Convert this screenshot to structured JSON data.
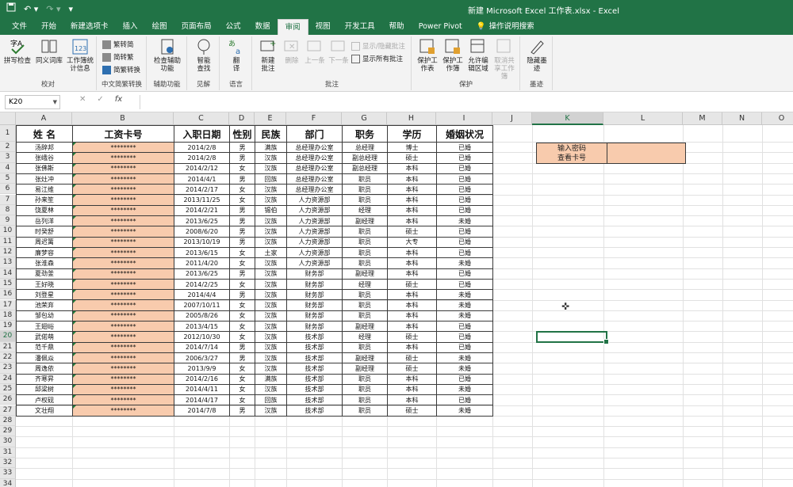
{
  "window": {
    "title": "新建 Microsoft Excel 工作表.xlsx  -  Excel"
  },
  "quick_access": {
    "save_icon": "save-icon",
    "undo_icon": "undo-icon",
    "redo_icon": "redo-icon",
    "customize_icon": "customize-icon"
  },
  "tabs": [
    {
      "label": "文件"
    },
    {
      "label": "开始"
    },
    {
      "label": "新建选项卡"
    },
    {
      "label": "插入"
    },
    {
      "label": "绘图"
    },
    {
      "label": "页面布局"
    },
    {
      "label": "公式"
    },
    {
      "label": "数据"
    },
    {
      "label": "审阅",
      "active": true
    },
    {
      "label": "视图"
    },
    {
      "label": "开发工具"
    },
    {
      "label": "帮助"
    },
    {
      "label": "Power Pivot"
    },
    {
      "label": "操作说明搜索"
    }
  ],
  "ribbon": {
    "proofing": {
      "label": "校对",
      "spell": "拼写检查",
      "thesaurus": "同义词库",
      "stats": "工作簿统计信息"
    },
    "chinese": {
      "label": "中文简繁转换",
      "to_simplified": "繁转简",
      "to_traditional": "简转繁",
      "convert": "简繁转换"
    },
    "accessibility": {
      "label": "辅助功能",
      "check": "检查辅助功能"
    },
    "insights": {
      "label": "见解",
      "smart": "智能查找"
    },
    "language": {
      "label": "语言",
      "translate": "翻译"
    },
    "comments": {
      "label": "批注",
      "new": "新建批注",
      "delete": "删除",
      "prev": "上一条",
      "next": "下一条",
      "show_hide": "显示/隐藏批注",
      "show_all": "显示所有批注"
    },
    "protect": {
      "label": "保护",
      "sheet": "保护工作表",
      "workbook": "保护工作簿",
      "allow_edit": "允许编辑区域",
      "unshare": "取消共享工作簿"
    },
    "ink": {
      "label": "墨迹",
      "hide_ink": "隐藏墨迹"
    }
  },
  "formula_bar": {
    "name_box": "K20",
    "cancel": "✕",
    "enter": "✓",
    "fx": "fx",
    "value": ""
  },
  "columns": [
    "A",
    "B",
    "C",
    "D",
    "E",
    "F",
    "G",
    "H",
    "I",
    "J",
    "K",
    "L",
    "M",
    "N",
    "O"
  ],
  "rows": [
    "1",
    "2",
    "3",
    "4",
    "5",
    "6",
    "7",
    "8",
    "9",
    "10",
    "11",
    "12",
    "13",
    "14",
    "15",
    "16",
    "17",
    "18",
    "19",
    "20",
    "21",
    "22",
    "23",
    "24",
    "25",
    "26",
    "27",
    "28",
    "29",
    "30",
    "31",
    "32",
    "33",
    "34",
    "35"
  ],
  "table": {
    "headers": [
      "姓 名",
      "工资卡号",
      "入职日期",
      "性别",
      "民族",
      "部门",
      "职务",
      "学历",
      "婚姻状况"
    ],
    "rows": [
      [
        "汤辞邦",
        "********",
        "2014/2/8",
        "男",
        "满族",
        "总经理办公室",
        "总经理",
        "博士",
        "已婚"
      ],
      [
        "张峨谷",
        "********",
        "2014/2/8",
        "男",
        "汉族",
        "总经理办公室",
        "副总经理",
        "硕士",
        "已婚"
      ],
      [
        "张佛斯",
        "********",
        "2014/2/12",
        "女",
        "汉族",
        "总经理办公室",
        "副总经理",
        "本科",
        "已婚"
      ],
      [
        "张灶冲",
        "********",
        "2014/4/1",
        "男",
        "回族",
        "总经理办公室",
        "职员",
        "本科",
        "已婚"
      ],
      [
        "易江维",
        "********",
        "2014/2/17",
        "女",
        "汉族",
        "总经理办公室",
        "职员",
        "本科",
        "已婚"
      ],
      [
        "孙来笙",
        "********",
        "2013/11/25",
        "女",
        "汉族",
        "人力资源部",
        "职员",
        "本科",
        "已婚"
      ],
      [
        "饶夏林",
        "********",
        "2014/2/21",
        "男",
        "锡伯",
        "人力资源部",
        "经理",
        "本科",
        "已婚"
      ],
      [
        "岳列洋",
        "********",
        "2013/6/25",
        "男",
        "汉族",
        "人力资源部",
        "副经理",
        "本科",
        "未婚"
      ],
      [
        "时癸舒",
        "********",
        "2008/6/20",
        "男",
        "汉族",
        "人力资源部",
        "职员",
        "硕士",
        "已婚"
      ],
      [
        "周迟篱",
        "********",
        "2013/10/19",
        "男",
        "汉族",
        "人力资源部",
        "职员",
        "大专",
        "已婚"
      ],
      [
        "廉梦容",
        "********",
        "2013/6/15",
        "女",
        "土家",
        "人力资源部",
        "职员",
        "本科",
        "已婚"
      ],
      [
        "张淮森",
        "********",
        "2011/4/20",
        "女",
        "汉族",
        "人力资源部",
        "职员",
        "本科",
        "未婚"
      ],
      [
        "夏劲釜",
        "********",
        "2013/6/25",
        "男",
        "汉族",
        "财务部",
        "副经理",
        "本科",
        "已婚"
      ],
      [
        "王好晓",
        "********",
        "2014/2/25",
        "女",
        "汉族",
        "财务部",
        "经理",
        "硕士",
        "已婚"
      ],
      [
        "刘登星",
        "********",
        "2014/4/4",
        "男",
        "汉族",
        "财务部",
        "职员",
        "本科",
        "未婚"
      ],
      [
        "池荣弃",
        "********",
        "2007/10/11",
        "女",
        "汉族",
        "财务部",
        "职员",
        "本科",
        "未婚"
      ],
      [
        "邹包幼",
        "********",
        "2005/8/26",
        "女",
        "汉族",
        "财务部",
        "职员",
        "本科",
        "未婚"
      ],
      [
        "王翅峪",
        "********",
        "2013/4/15",
        "女",
        "汉族",
        "财务部",
        "副经理",
        "本科",
        "已婚"
      ],
      [
        "武偌萌",
        "********",
        "2012/10/30",
        "女",
        "汉族",
        "技术部",
        "经理",
        "硕士",
        "已婚"
      ],
      [
        "范千鼎",
        "********",
        "2014/7/14",
        "男",
        "汉族",
        "技术部",
        "职员",
        "本科",
        "已婚"
      ],
      [
        "潘佩焱",
        "********",
        "2006/3/27",
        "男",
        "汉族",
        "技术部",
        "副经理",
        "硕士",
        "未婚"
      ],
      [
        "周逸依",
        "********",
        "2013/9/9",
        "女",
        "汉族",
        "技术部",
        "副经理",
        "硕士",
        "未婚"
      ],
      [
        "齐寒昇",
        "********",
        "2014/2/16",
        "女",
        "满族",
        "技术部",
        "职员",
        "本科",
        "已婚"
      ],
      [
        "邱梁树",
        "********",
        "2014/4/11",
        "女",
        "汉族",
        "技术部",
        "职员",
        "本科",
        "未婚"
      ],
      [
        "卢权砚",
        "********",
        "2014/4/17",
        "女",
        "回族",
        "技术部",
        "职员",
        "本科",
        "已婚"
      ],
      [
        "文壮翔",
        "********",
        "2014/7/8",
        "男",
        "汉族",
        "技术部",
        "职员",
        "硕士",
        "未婚"
      ]
    ]
  },
  "password_panel": {
    "label": "输入密码\n查看卡号",
    "line1": "输入密码",
    "line2": "查看卡号",
    "value": ""
  },
  "colors": {
    "excel_green": "#217346",
    "card_fill": "#f8cbad"
  }
}
